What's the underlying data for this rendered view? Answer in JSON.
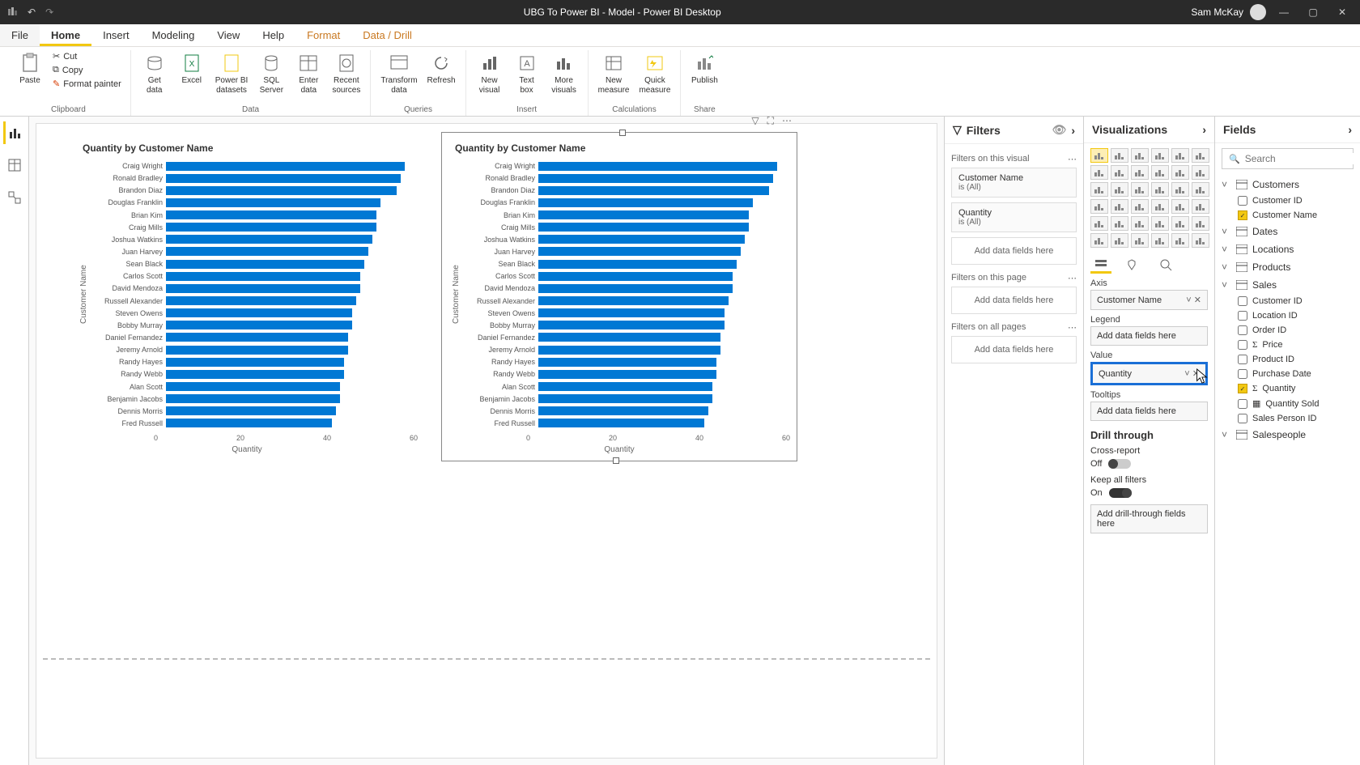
{
  "titlebar": {
    "title": "UBG To Power BI - Model - Power BI Desktop",
    "user": "Sam McKay"
  },
  "menu": {
    "file": "File",
    "home": "Home",
    "insert": "Insert",
    "modeling": "Modeling",
    "view": "View",
    "help": "Help",
    "format": "Format",
    "data_drill": "Data / Drill"
  },
  "ribbon": {
    "paste": "Paste",
    "cut": "Cut",
    "copy": "Copy",
    "format_painter": "Format painter",
    "clipboard": "Clipboard",
    "get_data": "Get\ndata",
    "excel": "Excel",
    "pbi_datasets": "Power BI\ndatasets",
    "sql_server": "SQL\nServer",
    "enter_data": "Enter\ndata",
    "recent_sources": "Recent\nsources",
    "data": "Data",
    "transform_data": "Transform\ndata",
    "refresh": "Refresh",
    "queries": "Queries",
    "new_visual": "New\nvisual",
    "text_box": "Text\nbox",
    "more_visuals": "More\nvisuals",
    "insert": "Insert",
    "new_measure": "New\nmeasure",
    "quick_measure": "Quick\nmeasure",
    "calculations": "Calculations",
    "publish": "Publish",
    "share": "Share"
  },
  "filters": {
    "title": "Filters",
    "visual_section": "Filters on this visual",
    "filter1_name": "Customer Name",
    "filter1_val": "is (All)",
    "filter2_name": "Quantity",
    "filter2_val": "is (All)",
    "add_fields": "Add data fields here",
    "page_section": "Filters on this page",
    "allpages_section": "Filters on all pages"
  },
  "viz": {
    "title": "Visualizations",
    "axis": "Axis",
    "axis_field": "Customer Name",
    "legend": "Legend",
    "add_fields": "Add data fields here",
    "value": "Value",
    "value_field": "Quantity",
    "tooltips": "Tooltips",
    "drill_through": "Drill through",
    "cross_report": "Cross-report",
    "off": "Off",
    "keep_filters": "Keep all filters",
    "on": "On",
    "add_drill": "Add drill-through fields here"
  },
  "fields": {
    "title": "Fields",
    "search_placeholder": "Search",
    "tables": {
      "customers": "Customers",
      "customer_id": "Customer ID",
      "customer_name": "Customer Name",
      "dates": "Dates",
      "locations": "Locations",
      "products": "Products",
      "sales": "Sales",
      "s_customer_id": "Customer ID",
      "location_id": "Location ID",
      "order_id": "Order ID",
      "price": "Price",
      "product_id": "Product ID",
      "purchase_date": "Purchase Date",
      "quantity": "Quantity",
      "quantity_sold": "Quantity Sold",
      "sales_person_id": "Sales Person ID",
      "salespeople": "Salespeople"
    }
  },
  "chart_data": [
    {
      "type": "bar",
      "title": "Quantity by Customer Name",
      "ylabel": "Customer Name",
      "xlabel": "Quantity",
      "xlim": [
        0,
        60
      ],
      "xticks": [
        0,
        20,
        40,
        60
      ],
      "categories": [
        "Craig Wright",
        "Ronald Bradley",
        "Brandon Diaz",
        "Douglas Franklin",
        "Brian Kim",
        "Craig Mills",
        "Joshua Watkins",
        "Juan Harvey",
        "Sean Black",
        "Carlos Scott",
        "David Mendoza",
        "Russell Alexander",
        "Steven Owens",
        "Bobby Murray",
        "Daniel Fernandez",
        "Jeremy Arnold",
        "Randy Hayes",
        "Randy Webb",
        "Alan Scott",
        "Benjamin Jacobs",
        "Dennis Morris",
        "Fred Russell"
      ],
      "values": [
        59,
        58,
        57,
        53,
        52,
        52,
        51,
        50,
        49,
        48,
        48,
        47,
        46,
        46,
        45,
        45,
        44,
        44,
        43,
        43,
        42,
        41
      ]
    },
    {
      "type": "bar",
      "title": "Quantity by Customer Name",
      "ylabel": "Customer Name",
      "xlabel": "Quantity",
      "xlim": [
        0,
        60
      ],
      "xticks": [
        0,
        20,
        40,
        60
      ],
      "categories": [
        "Craig Wright",
        "Ronald Bradley",
        "Brandon Diaz",
        "Douglas Franklin",
        "Brian Kim",
        "Craig Mills",
        "Joshua Watkins",
        "Juan Harvey",
        "Sean Black",
        "Carlos Scott",
        "David Mendoza",
        "Russell Alexander",
        "Steven Owens",
        "Bobby Murray",
        "Daniel Fernandez",
        "Jeremy Arnold",
        "Randy Hayes",
        "Randy Webb",
        "Alan Scott",
        "Benjamin Jacobs",
        "Dennis Morris",
        "Fred Russell"
      ],
      "values": [
        59,
        58,
        57,
        53,
        52,
        52,
        51,
        50,
        49,
        48,
        48,
        47,
        46,
        46,
        45,
        45,
        44,
        44,
        43,
        43,
        42,
        41
      ]
    }
  ]
}
